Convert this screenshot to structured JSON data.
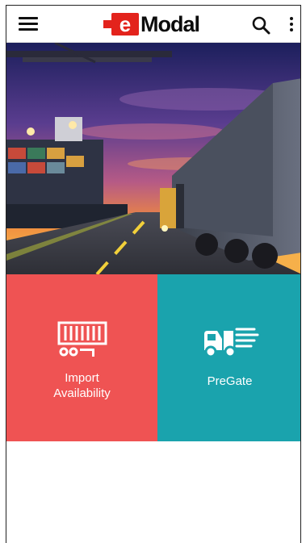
{
  "header": {
    "logo_e": "e",
    "logo_text": "Modal",
    "menu_icon": "hamburger-menu-icon",
    "search_icon": "search-icon",
    "more_icon": "more-vertical-icon"
  },
  "hero": {
    "image": "port-and-truck-sunset-photo"
  },
  "tiles": [
    {
      "label_line1": "Import",
      "label_line2": "Availability",
      "icon": "container-on-chassis-icon",
      "color": "#ef5353"
    },
    {
      "label": "PreGate",
      "icon": "truck-fast-icon",
      "color": "#1aa3ad"
    }
  ],
  "colors": {
    "brand_red": "#e3231c",
    "import_tile": "#ef5353",
    "pregate_tile": "#1aa3ad"
  }
}
